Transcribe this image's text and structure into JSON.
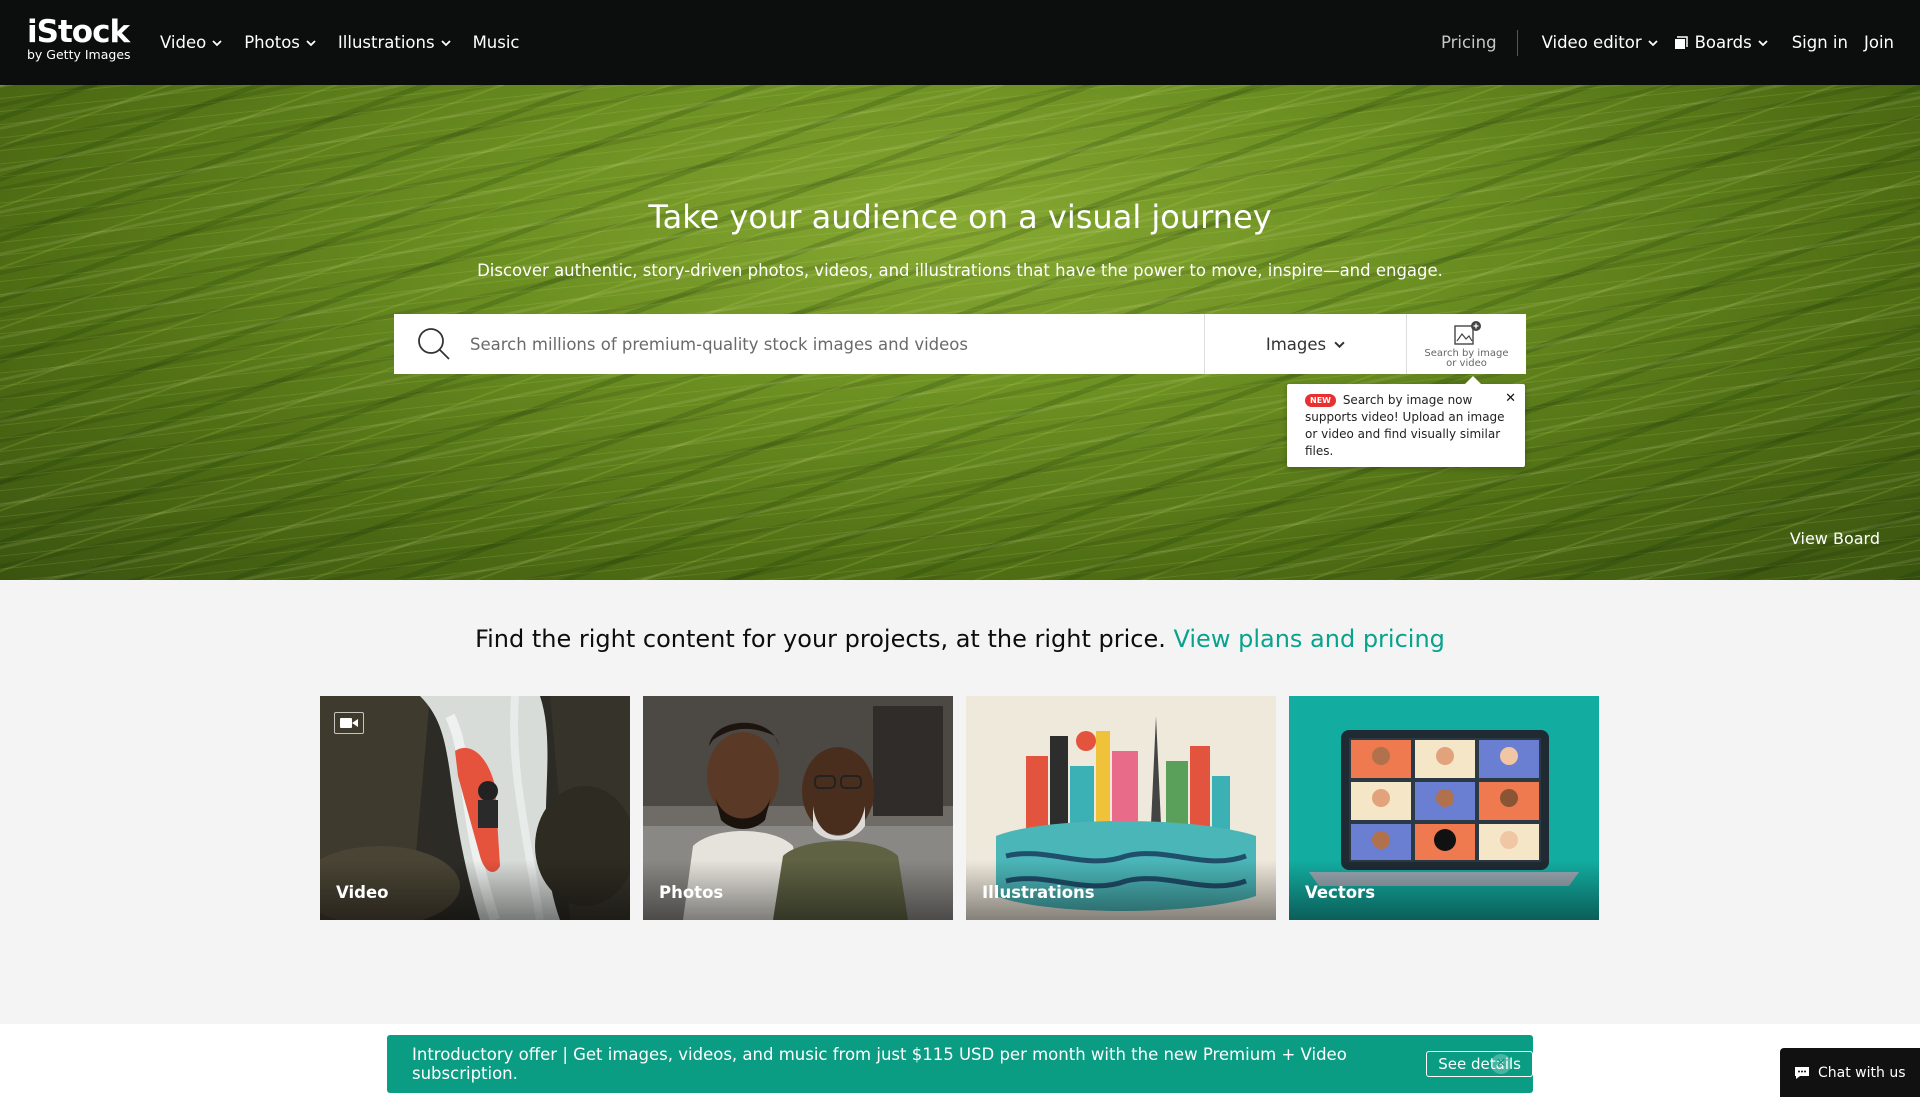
{
  "nav": {
    "logo_brand": "iStock",
    "logo_sub": "by Getty Images",
    "left_items": [
      "Video",
      "Photos",
      "Illustrations",
      "Music"
    ],
    "pricing": "Pricing",
    "video_editor": "Video editor",
    "boards": "Boards",
    "sign_in": "Sign in",
    "join": "Join"
  },
  "hero": {
    "title": "Take your audience on a visual journey",
    "subtitle": "Discover authentic, story-driven photos, videos, and illustrations that have the power to move, inspire—and engage.",
    "search_placeholder": "Search millions of premium-quality stock images and videos",
    "search_type": "Images",
    "search_by_image_line1": "Search by image",
    "search_by_image_line2": "or video",
    "tooltip_badge": "NEW",
    "tooltip_text": "Search by image now supports video! Upload an image or video and find visually similar files.",
    "tooltip_close": "✕",
    "view_board": "View Board"
  },
  "content": {
    "find_text": "Find the right content for your projects, at the right price.",
    "find_link": "View plans and pricing",
    "cards": [
      {
        "label": "Video"
      },
      {
        "label": "Photos"
      },
      {
        "label": "Illustrations"
      },
      {
        "label": "Vectors"
      }
    ]
  },
  "banner": {
    "text": "Introductory offer | Get images, videos, and music from just $115 USD per month with the new Premium + Video subscription.",
    "details": "See details",
    "close": "✕"
  },
  "chat": {
    "label": "Chat with us"
  },
  "colors": {
    "nav_bg": "#0c0d0d",
    "accent_teal": "#08a38d",
    "banner_bg": "#0a9d83",
    "badge_red": "#e8312f"
  }
}
